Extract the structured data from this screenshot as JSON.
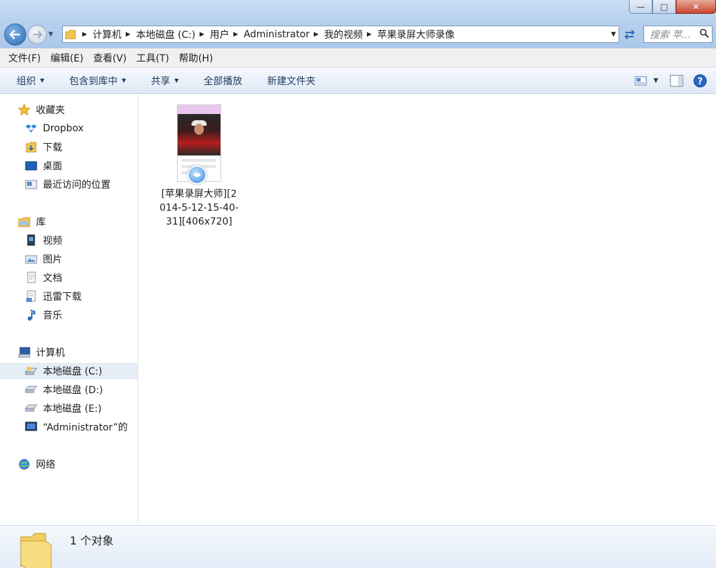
{
  "window": {
    "controls": {
      "minimize": "—",
      "maximize": "□",
      "close": "✕"
    }
  },
  "address": {
    "crumbs": [
      "计算机",
      "本地磁盘 (C:)",
      "用户",
      "Administrator",
      "我的视频",
      "苹果录屏大师录像"
    ]
  },
  "search": {
    "placeholder": "搜索 苹..."
  },
  "menu": {
    "items": [
      "文件(F)",
      "编辑(E)",
      "查看(V)",
      "工具(T)",
      "帮助(H)"
    ]
  },
  "toolbar": {
    "organize": "组织",
    "include_in_library": "包含到库中",
    "share": "共享",
    "play_all": "全部播放",
    "new_folder": "新建文件夹"
  },
  "sidebar": {
    "favorites_header": "收藏夹",
    "favorites": [
      "Dropbox",
      "下载",
      "桌面",
      "最近访问的位置"
    ],
    "libraries_header": "库",
    "libraries": [
      "视频",
      "图片",
      "文档",
      "迅雷下载",
      "音乐"
    ],
    "computer_header": "计算机",
    "drives": [
      "本地磁盘 (C:)",
      "本地磁盘 (D:)",
      "本地磁盘 (E:)",
      "“Administrator”的"
    ],
    "network_header": "网络"
  },
  "file": {
    "name": "[苹果录屏大师][2014-5-12-15-40-31][406x720]"
  },
  "status": {
    "text": "1 个对象"
  },
  "colors": {
    "accent": "#2c66ad",
    "selected_row": "#e6edf6",
    "statusbar": "#e3ecf7"
  }
}
